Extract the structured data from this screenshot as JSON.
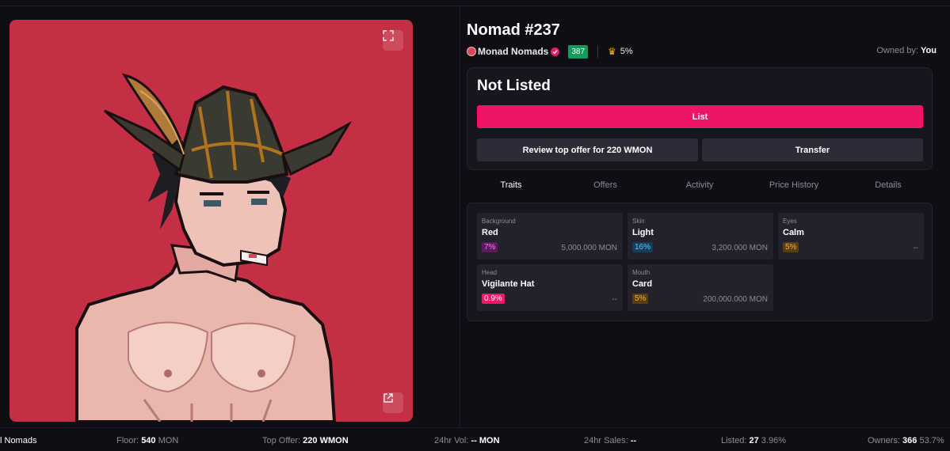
{
  "nft": {
    "title": "Nomad #237",
    "collection": "Monad Nomads",
    "rank": "387",
    "rarity": "5%",
    "owned_label": "Owned by:",
    "owner": "You"
  },
  "listing": {
    "status": "Not Listed",
    "list_button": "List",
    "review_button": "Review top offer for 220 WMON",
    "transfer_button": "Transfer"
  },
  "tabs": [
    "Traits",
    "Offers",
    "Activity",
    "Price History",
    "Details"
  ],
  "traits": [
    {
      "name": "Background",
      "value": "Red",
      "pct": "7%",
      "price": "5,000.000 MON",
      "pct_style": "purple"
    },
    {
      "name": "Skin",
      "value": "Light",
      "pct": "16%",
      "price": "3,200.000 MON",
      "pct_style": "blue"
    },
    {
      "name": "Eyes",
      "value": "Calm",
      "pct": "5%",
      "price": "--",
      "pct_style": "orange"
    },
    {
      "name": "Head",
      "value": "Vigilante Hat",
      "pct": "0.9%",
      "price": "--",
      "pct_style": "pink"
    },
    {
      "name": "Mouth",
      "value": "Card",
      "pct": "5%",
      "price": "200,000.000 MON",
      "pct_style": "orange"
    }
  ],
  "footer": {
    "collection_fragment": "l Nomads",
    "floor_label": "Floor:",
    "floor_value": "540",
    "floor_unit": "MON",
    "top_offer_label": "Top Offer:",
    "top_offer_value": "220",
    "top_offer_unit": "WMON",
    "vol_label": "24hr Vol:",
    "vol_value": "--",
    "vol_unit": "MON",
    "sales_label": "24hr Sales:",
    "sales_value": "--",
    "listed_label": "Listed:",
    "listed_value": "27",
    "listed_pct": "3.96%",
    "owners_label": "Owners:",
    "owners_value": "366",
    "owners_pct": "53.7%"
  },
  "colors": {
    "accent": "#ed1566",
    "art_background": "#c42f45",
    "rank_green": "#149a5a"
  }
}
